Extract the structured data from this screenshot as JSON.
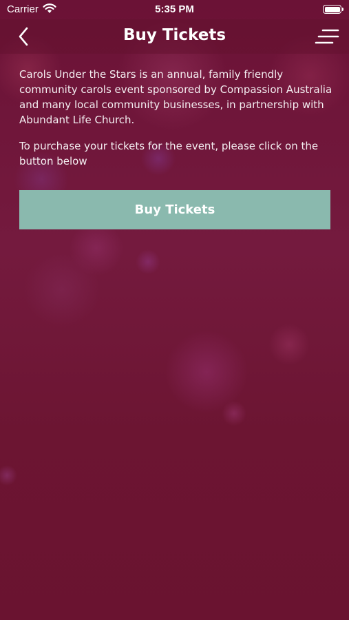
{
  "status_bar": {
    "carrier": "Carrier",
    "time": "5:35 PM",
    "icons": [
      "wifi-icon",
      "battery-icon"
    ]
  },
  "nav": {
    "title": "Buy Tickets",
    "back_icon": "chevron-left-icon",
    "menu_icon": "menu-icon"
  },
  "content": {
    "paragraphs": [
      "Carols Under the Stars is an annual, family friendly community carols event sponsored by Compassion Australia and many local community businesses, in partnership with Abundant Life Church.",
      "To purchase your tickets for the event, please click on the button below"
    ],
    "button_label": "Buy Tickets"
  },
  "colors": {
    "background": "#6e1433",
    "button": "#8ab9ae",
    "text": "#ffffff"
  }
}
